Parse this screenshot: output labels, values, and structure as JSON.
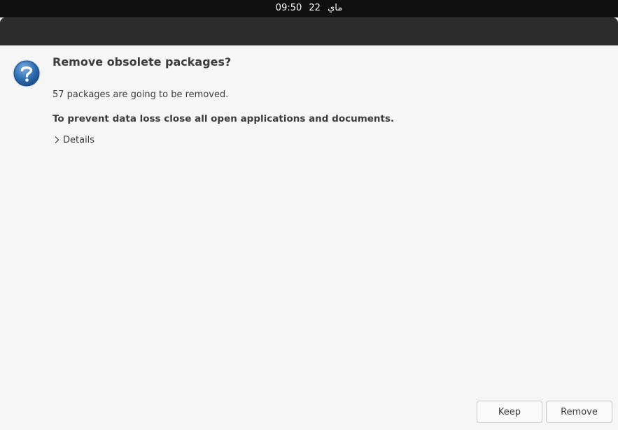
{
  "topbar": {
    "time": "09:50",
    "day": "22",
    "month": "ماي"
  },
  "dialog": {
    "icon": "question-icon",
    "title": "Remove obsolete packages?",
    "subtitle": "57 packages are going to be removed.",
    "warning": "To prevent data loss close all open applications and documents.",
    "details_label": "Details",
    "buttons": {
      "keep": "Keep",
      "remove": "Remove"
    }
  },
  "colors": {
    "topbar": "#101010",
    "titlebar": "#2c2c2c",
    "dialog_bg": "#f6f6f6",
    "icon_blue": "#2a6db0"
  }
}
